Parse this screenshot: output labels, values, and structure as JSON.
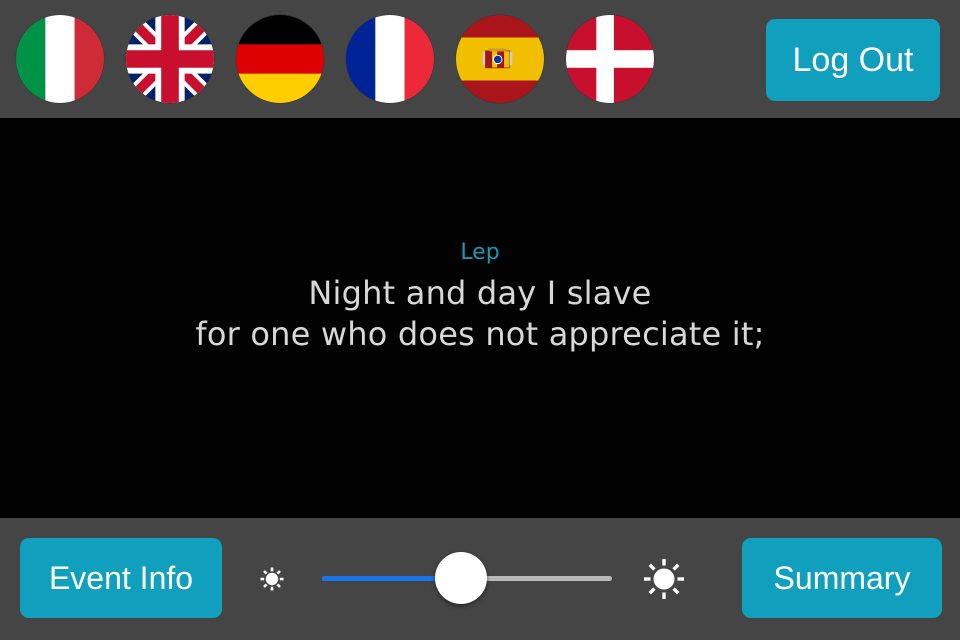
{
  "top_bar": {
    "flags": [
      {
        "name": "flag-italy",
        "country": "Italy",
        "code": "it",
        "colors": [
          "#009246",
          "#ffffff",
          "#ce2b37"
        ]
      },
      {
        "name": "flag-united-kingdom",
        "country": "United Kingdom",
        "code": "gb",
        "colors": [
          "#012169",
          "#ffffff",
          "#c8102e"
        ]
      },
      {
        "name": "flag-germany",
        "country": "Germany",
        "code": "de",
        "colors": [
          "#000000",
          "#dd0000",
          "#ffce00"
        ]
      },
      {
        "name": "flag-france",
        "country": "France",
        "code": "fr",
        "colors": [
          "#002395",
          "#ffffff",
          "#ed2939"
        ]
      },
      {
        "name": "flag-spain",
        "country": "Spain",
        "code": "es",
        "colors": [
          "#aa151b",
          "#f1bf00"
        ]
      },
      {
        "name": "flag-denmark",
        "country": "Denmark",
        "code": "dk",
        "colors": [
          "#c8102e",
          "#ffffff"
        ]
      }
    ],
    "logout_label": "Log Out"
  },
  "stage": {
    "speaker": "Lep",
    "caption_lines": [
      "Night and day I slave",
      "for one who does not appreciate it;"
    ]
  },
  "bottom_bar": {
    "event_info_label": "Event Info",
    "summary_label": "Summary",
    "brightness": {
      "low_icon": "sun-small-icon",
      "high_icon": "sun-large-icon",
      "value_percent": 48,
      "min": 0,
      "max": 100
    }
  },
  "colors": {
    "accent": "#10a0bd",
    "bar_background": "#454545",
    "stage_background": "#020202",
    "speaker_text": "#1a9ab2",
    "caption_text": "#d8d8d8",
    "slider_fill": "#1a73e8",
    "slider_track": "#b9b9b9"
  }
}
